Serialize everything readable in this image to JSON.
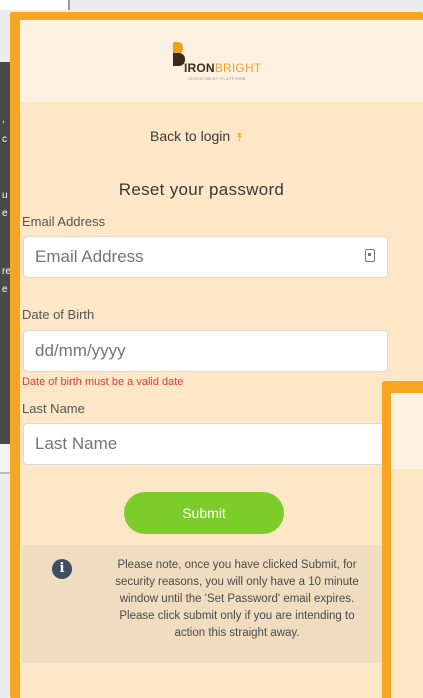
{
  "brand": {
    "logo_primary": "IRON",
    "logo_secondary": "BRIGHT",
    "tagline": "INVESTMENT PLATFORM",
    "accent_color": "#f6a623",
    "dark_color": "#3d2c1e"
  },
  "background_panel": {
    "fragments": [
      ",",
      "c",
      "u",
      "e",
      "re",
      "e"
    ]
  },
  "nav": {
    "back_label": "Back to login",
    "back_icon": "double-chevron-up-icon"
  },
  "form": {
    "title": "Reset your password",
    "email": {
      "label": "Email Address",
      "placeholder": "Email Address",
      "value": "",
      "icon": "id-card-icon"
    },
    "dob": {
      "label": "Date of Birth",
      "placeholder": "dd/mm/yyyy",
      "value": "",
      "error": "Date of birth must be a valid date"
    },
    "last_name": {
      "label": "Last Name",
      "placeholder": "Last Name",
      "value": ""
    },
    "submit_label": "Submit",
    "submit_color": "#7ccc2a",
    "error_color": "#e0393e"
  },
  "notice": {
    "icon": "info-icon",
    "lines": [
      "Please note, once you have clicked Submit, for",
      "security reasons, you will only have a 10 minute",
      "window until the 'Set Password' email expires.",
      "Please click submit only if you are intending to",
      "action this straight away."
    ]
  }
}
